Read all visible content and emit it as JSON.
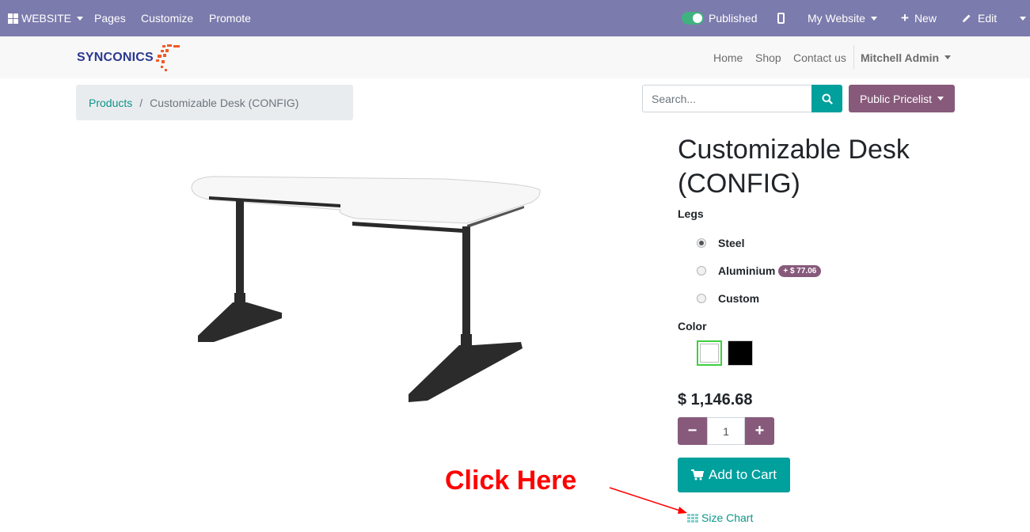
{
  "admin_bar": {
    "website_label": "WEBSITE",
    "pages": "Pages",
    "customize": "Customize",
    "promote": "Promote",
    "published": "Published",
    "my_website": "My Website",
    "new": "New",
    "edit": "Edit"
  },
  "nav": {
    "logo_text": "SYNCONICS",
    "home": "Home",
    "shop": "Shop",
    "contact": "Contact us",
    "user": "Mitchell Admin"
  },
  "breadcrumb": {
    "parent": "Products",
    "separator": "/",
    "current": "Customizable Desk (CONFIG)"
  },
  "search": {
    "placeholder": "Search...",
    "pricelist": "Public Pricelist"
  },
  "product": {
    "title": "Customizable Desk (CONFIG)",
    "legs_label": "Legs",
    "legs_options": [
      {
        "label": "Steel",
        "checked": true
      },
      {
        "label": "Aluminium",
        "extra": "+ $ 77.06",
        "checked": false
      },
      {
        "label": "Custom",
        "checked": false
      }
    ],
    "color_label": "Color",
    "colors": [
      "#ffffff",
      "#000000"
    ],
    "price": "$ 1,146.68",
    "quantity": "1",
    "add_to_cart": "Add to Cart",
    "size_chart": "Size Chart"
  },
  "annotation": {
    "click_here": "Click Here",
    "color": "#ff0000"
  },
  "colors": {
    "admin_bar": "#7c7bad",
    "primary": "#875a7b",
    "teal": "#00a09d"
  }
}
